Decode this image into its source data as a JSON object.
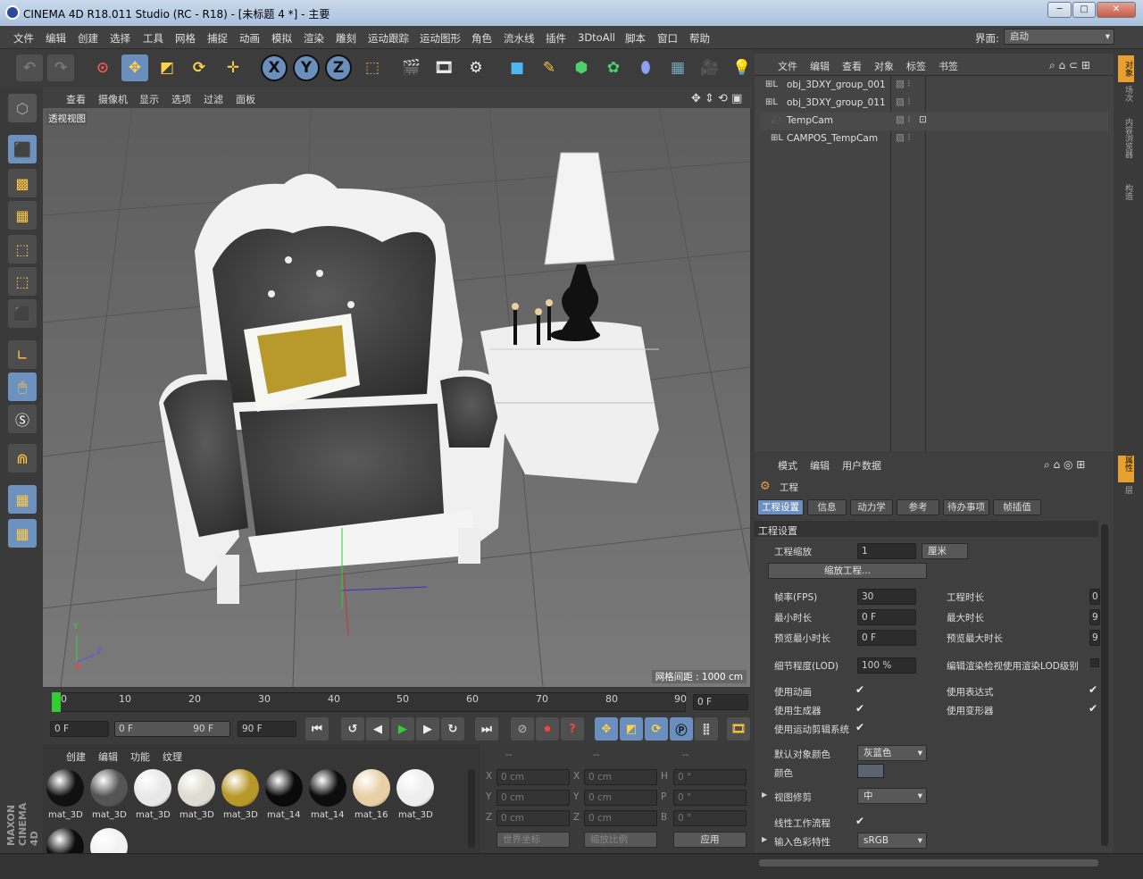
{
  "window": {
    "title": "CINEMA 4D R18.011 Studio (RC - R18) - [未标题 4 *] - 主要",
    "minimize": "─",
    "maximize": "□",
    "close": "✕"
  },
  "menu": [
    "文件",
    "编辑",
    "创建",
    "选择",
    "工具",
    "网格",
    "捕捉",
    "动画",
    "模拟",
    "渲染",
    "雕刻",
    "运动跟踪",
    "运动图形",
    "角色",
    "流水线",
    "插件",
    "3DtoAll",
    "脚本",
    "窗口",
    "帮助"
  ],
  "interface": {
    "label": "界面:",
    "value": "启动"
  },
  "toolbar": {
    "x": "X",
    "y": "Y",
    "z": "Z"
  },
  "viewport": {
    "menu": [
      "查看",
      "摄像机",
      "显示",
      "选项",
      "过滤",
      "面板"
    ],
    "label": "透视视图",
    "grid_spacing": "网格间距 : 1000 cm",
    "axis": {
      "y": "Y",
      "z": "Z",
      "x": "X"
    }
  },
  "timeline": {
    "ticks": [
      "0",
      "10",
      "20",
      "30",
      "40",
      "50",
      "60",
      "70",
      "80",
      "90"
    ],
    "current": "0 F",
    "start": "0 F",
    "range_start": "0 F",
    "range_end": "90 F",
    "end": "90 F"
  },
  "materials": {
    "menu": [
      "创建",
      "编辑",
      "功能",
      "纹理"
    ],
    "items": [
      {
        "name": "mat_3D",
        "color": "#111111"
      },
      {
        "name": "mat_3D",
        "color": "#555555"
      },
      {
        "name": "mat_3D",
        "color": "#e8e8e8"
      },
      {
        "name": "mat_3D",
        "color": "#dcdcd0"
      },
      {
        "name": "mat_3D",
        "color": "#b8982a"
      },
      {
        "name": "mat_14",
        "color": "#0a0a0a"
      },
      {
        "name": "mat_14",
        "color": "#0d0d0d"
      },
      {
        "name": "mat_16",
        "color": "#e9cfa8"
      },
      {
        "name": "mat_3D",
        "color": "#eeeeee"
      },
      {
        "name": "",
        "color": "#0c0c0c"
      },
      {
        "name": "",
        "color": "#f2f2f2"
      }
    ]
  },
  "coords": {
    "header": [
      "--",
      "--",
      "--"
    ],
    "rows": [
      {
        "a": "X",
        "av": "0 cm",
        "b": "X",
        "bv": "0 cm",
        "c": "H",
        "cv": "0 °"
      },
      {
        "a": "Y",
        "av": "0 cm",
        "b": "Y",
        "bv": "0 cm",
        "c": "P",
        "cv": "0 °"
      },
      {
        "a": "Z",
        "av": "0 cm",
        "b": "Z",
        "bv": "0 cm",
        "c": "B",
        "cv": "0 °"
      }
    ],
    "world": "世界坐标",
    "scale": "缩放比例",
    "apply": "应用"
  },
  "objects": {
    "menu": [
      "文件",
      "编辑",
      "查看",
      "对象",
      "标签",
      "书签"
    ],
    "items": [
      {
        "name": "obj_3DXY_group_001",
        "icon": "L0"
      },
      {
        "name": "obj_3DXY_group_011",
        "icon": "L0"
      },
      {
        "name": "TempCam",
        "icon": "cam"
      },
      {
        "name": "CAMPOS_TempCam",
        "icon": "L0"
      }
    ]
  },
  "attributes": {
    "menu": [
      "模式",
      "编辑",
      "用户数据"
    ],
    "title": "工程",
    "tabs": [
      "工程设置",
      "信息",
      "动力学",
      "参考",
      "待办事项",
      "帧插值"
    ],
    "section": "工程设置",
    "scale_label": "工程缩放",
    "scale_value": "1",
    "scale_unit": "厘米",
    "scale_button": "缩放工程...",
    "fps_label": "帧率(FPS)",
    "fps": "30",
    "project_len_label": "工程时长",
    "project_len": "0",
    "min_label": "最小时长",
    "min": "0 F",
    "max_label": "最大时长",
    "max": "9",
    "pmin_label": "预览最小时长",
    "pmin": "0 F",
    "pmax_label": "预览最大时长",
    "pmax": "9",
    "lod_label": "细节程度(LOD)",
    "lod": "100 %",
    "render_lod_label": "编辑渲染检视使用渲染LOD级别",
    "anim_label": "使用动画",
    "expr_label": "使用表达式",
    "gen_label": "使用生成器",
    "deform_label": "使用变形器",
    "motion_label": "使用运动剪辑系统",
    "defcolor_label": "默认对象颜色",
    "defcolor": "灰蓝色",
    "color_label": "颜色",
    "clip_label": "视图修剪",
    "clip": "中",
    "linear_label": "线性工作流程",
    "input_label": "输入色彩特性",
    "input": "sRGB",
    "swatch": "#5a6470"
  },
  "sidetabs": {
    "top": [
      "对象",
      "场次",
      "内容浏览器",
      "构造"
    ],
    "bottom": [
      "属性",
      "层"
    ]
  },
  "brand": "MAXON CINEMA 4D"
}
